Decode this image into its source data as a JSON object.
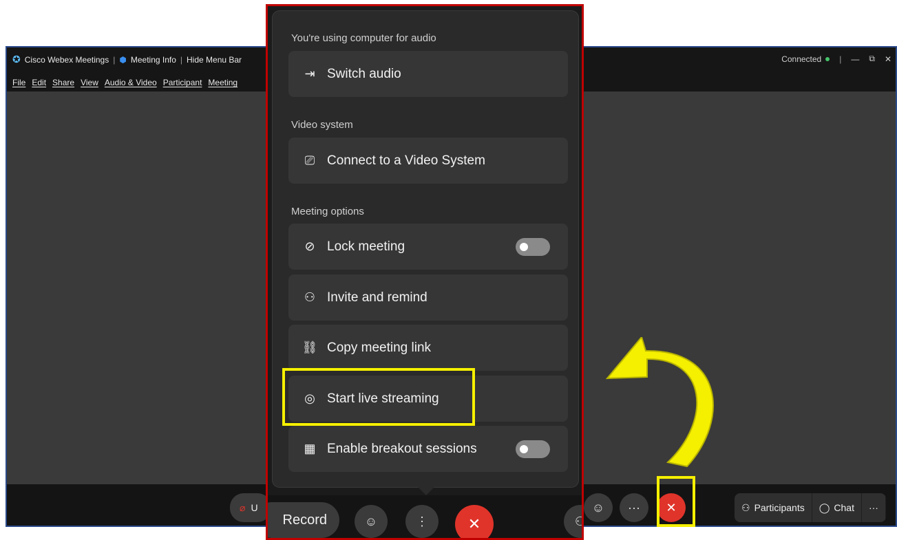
{
  "titlebar": {
    "app_name": "Cisco Webex Meetings",
    "meeting_info": "Meeting Info",
    "hide_menu": "Hide Menu Bar",
    "connection_status": "Connected",
    "minimize": "—",
    "restore": "⧉",
    "close": "✕"
  },
  "menubar": [
    "File",
    "Edit",
    "Share",
    "View",
    "Audio & Video",
    "Participant",
    "Meeting"
  ],
  "bottombar": {
    "unmute_partial": "U",
    "participants_label": "Participants",
    "chat_label": "Chat",
    "more": "···",
    "leave": "✕"
  },
  "menu": {
    "audio_section": "You're using computer for audio",
    "switch_audio": "Switch audio",
    "video_section": "Video system",
    "connect_video": "Connect to a Video System",
    "meeting_section": "Meeting options",
    "lock_meeting": "Lock meeting",
    "invite": "Invite and remind",
    "copy_link": "Copy meeting link",
    "live_stream": "Start live streaming",
    "breakout": "Enable breakout sessions",
    "lock_toggle_on": false,
    "breakout_toggle_on": false
  },
  "overlay_bottom": {
    "record": "Record",
    "more_vertical": "⋮",
    "end": "✕"
  },
  "colors": {
    "highlight": "#f5ef00",
    "overlay_border": "#c00000",
    "end_button": "#e0342a",
    "arrow": "#f5ef00"
  }
}
